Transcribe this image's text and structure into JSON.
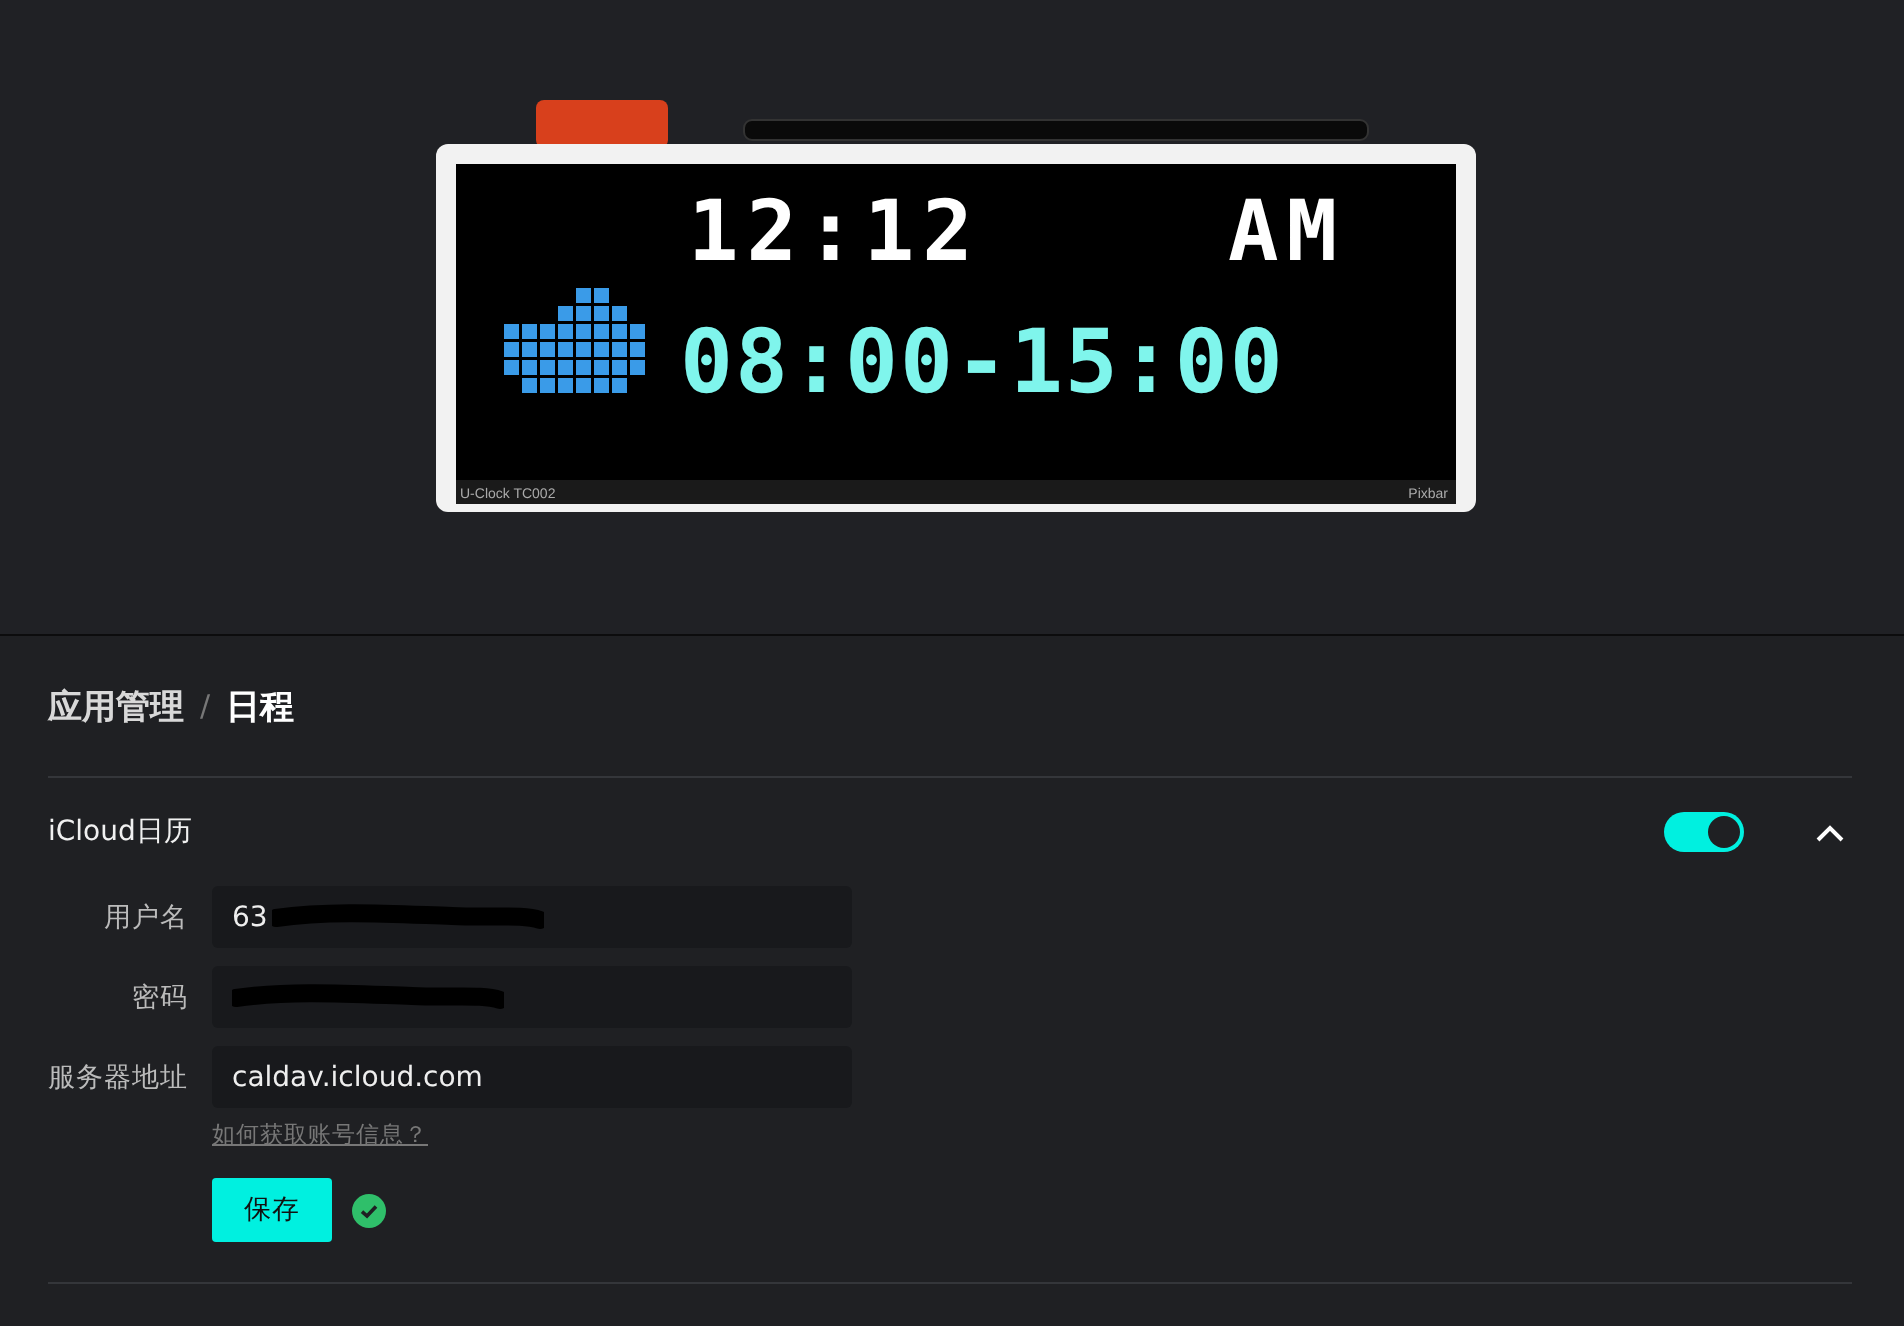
{
  "device_preview": {
    "time": "12:12",
    "meridiem": "AM",
    "schedule": "08:00-15:00",
    "model": "U-Clock TC002",
    "brand": "Pixbar"
  },
  "breadcrumb_separator": "/",
  "breadcrumb": [
    {
      "label": "应用管理",
      "current": false
    },
    {
      "label": "日程",
      "current": true
    }
  ],
  "section": {
    "title": "iCloud日历",
    "enabled": true,
    "expanded": true
  },
  "fields": [
    {
      "label": "用户名",
      "value": "63",
      "redacted": true
    },
    {
      "label": "密码",
      "redacted": true
    },
    {
      "label": "服务器地址",
      "value": "caldav.icloud.com",
      "redacted": false
    }
  ],
  "help_link": "如何获取账号信息？",
  "save_button": "保存",
  "saved": true
}
